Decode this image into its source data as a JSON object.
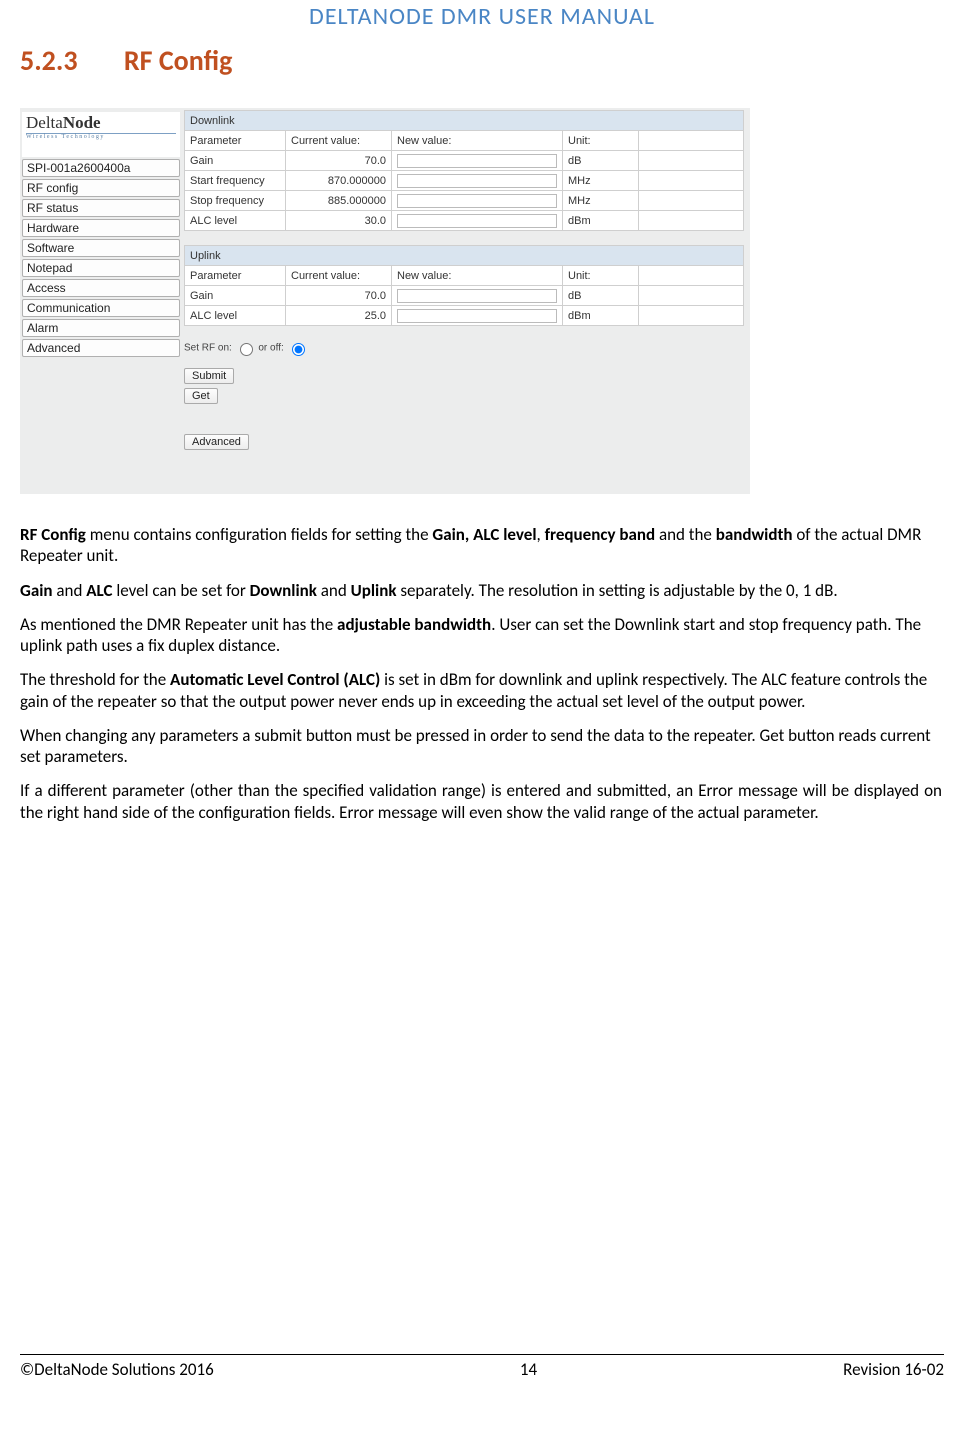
{
  "header": {
    "title": "DELTANODE DMR USER MANUAL"
  },
  "section": {
    "number": "5.2.3",
    "title": "RF Config"
  },
  "screenshot": {
    "logo": {
      "line1a": "Delta",
      "line1b": "Node",
      "line2": "Wireless  Technology"
    },
    "nav": [
      "SPI-001a2600400a",
      "RF config",
      "RF status",
      "Hardware",
      "Software",
      "Notepad",
      "Access",
      "Communication",
      "Alarm",
      "Advanced"
    ],
    "downlink": {
      "caption": "Downlink",
      "headers": [
        "Parameter",
        "Current value:",
        "New value:",
        "Unit:"
      ],
      "rows": [
        {
          "param": "Gain",
          "cv": "70.0",
          "unit": "dB"
        },
        {
          "param": "Start frequency",
          "cv": "870.000000",
          "unit": "MHz"
        },
        {
          "param": "Stop frequency",
          "cv": "885.000000",
          "unit": "MHz"
        },
        {
          "param": "ALC level",
          "cv": "30.0",
          "unit": "dBm"
        }
      ]
    },
    "uplink": {
      "caption": "Uplink",
      "headers": [
        "Parameter",
        "Current value:",
        "New value:",
        "Unit:"
      ],
      "rows": [
        {
          "param": "Gain",
          "cv": "70.0",
          "unit": "dB"
        },
        {
          "param": "ALC level",
          "cv": "25.0",
          "unit": "dBm"
        }
      ]
    },
    "rf_toggle": {
      "label_on": "Set RF on:",
      "label_off": "or off:"
    },
    "buttons": {
      "submit": "Submit",
      "get": "Get",
      "advanced": "Advanced"
    }
  },
  "body": {
    "p1a": "RF Config",
    "p1b": " menu contains configuration fields for setting the ",
    "p1c": "Gain, ALC level",
    "p1d": ", ",
    "p1e": "frequency band",
    "p1f": " and the ",
    "p1g": "bandwidth",
    "p1h": " of the actual DMR Repeater unit.",
    "p2a": "Gain",
    "p2b": " and ",
    "p2c": "ALC",
    "p2d": " level can be set for ",
    "p2e": "Downlink",
    "p2f": " and ",
    "p2g": "Uplink",
    "p2h": " separately. The resolution in setting is adjustable by the 0, 1 dB.",
    "p3a": "As mentioned the DMR Repeater unit has the ",
    "p3b": "adjustable bandwidth",
    "p3c": ". User can set the Downlink start and stop frequency path. The uplink path uses a fix duplex distance.",
    "p4a": "The threshold for the ",
    "p4b": "Automatic Level Control (ALC)",
    "p4c": " is set in dBm for downlink and uplink respectively. The ALC feature controls the gain of the repeater so that the output power never ends up in exceeding the actual set level of the output power.",
    "p5": "When changing any parameters a submit button must be pressed in order to send the data to the repeater. Get button reads current set parameters.",
    "p6": "If  a  different  parameter  (other  than  the  specified  validation  range)  is  entered  and  submitted,  an Error  message will be displayed on the right hand side of the configuration fields. Error message will even   show the valid range of the actual parameter."
  },
  "footer": {
    "left": "©DeltaNode Solutions 2016",
    "center": "14",
    "right": "Revision 16-02"
  }
}
